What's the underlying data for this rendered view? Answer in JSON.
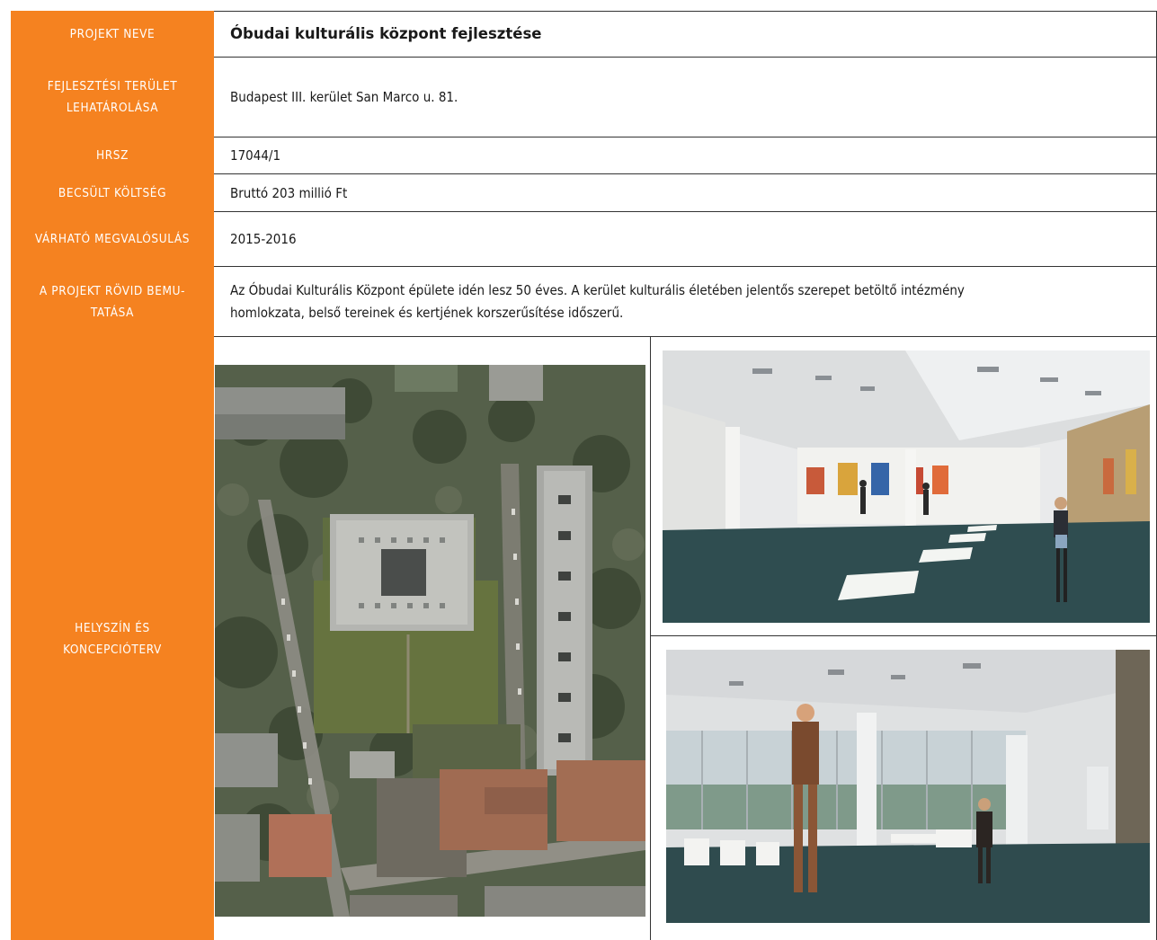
{
  "labels": {
    "projekt_neve": "PROJEKT NEVE",
    "terulet_1": "FEJLESZTÉSI TERÜLET",
    "terulet_2": "LEHATÁROLÁSA",
    "hrsz": "HRSZ",
    "koltseg": "BECSÜLT KÖLTSÉG",
    "megvalosulas": "VÁRHATÓ MEGVALÓSULÁS",
    "bemutatas_1": "A PROJEKT RÖVID BEMU-",
    "bemutatas_2": "TATÁSA",
    "helyszin_1": "HELYSZÍN ÉS",
    "helyszin_2": "KONCEPCIÓTERV"
  },
  "values": {
    "projekt_neve": "Óbudai kulturális központ fejlesztése",
    "terulet": "Budapest III. kerület San Marco u. 81.",
    "hrsz": "17044/1",
    "koltseg": "Bruttó 203 millió Ft",
    "megvalosulas": "2015-2016",
    "bemutatas_1": "Az Óbudai Kulturális Központ épülete idén lesz 50 éves. A kerület kulturális életében jelentős szerepet betöltő intézmény",
    "bemutatas_2": "homlokzata, belső tereinek és kertjének korszerűsítése időszerű."
  },
  "colors": {
    "label_bg": "#f58220",
    "label_text": "#ffffff",
    "border": "#333333"
  }
}
